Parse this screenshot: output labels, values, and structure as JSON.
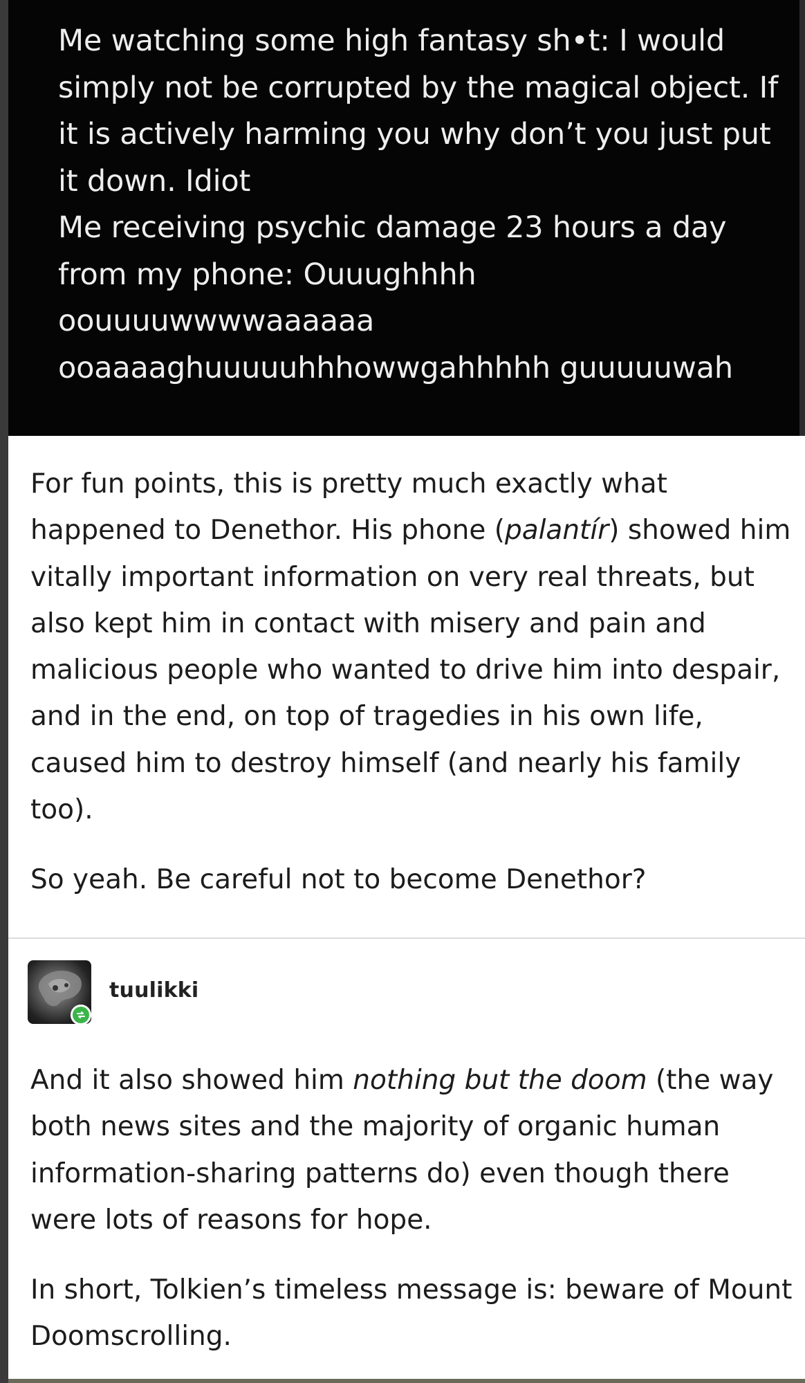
{
  "original_tweet": {
    "text": "Me watching some high fantasy sh•t: I would simply not be corrupted by the magical object. If it is actively harming you why don’t you just put it down. Idiot\nMe receiving psychic damage 23 hours a day from my phone: Ouuughhhh oouuuuwwwwaaaaaa ooaaaaghuuuuuhhhowwgahhhhh guuuuuwah"
  },
  "reply_1": {
    "p1_a": "For fun points, this is pretty much exactly what happened to Denethor. His phone (",
    "p1_italic": "palantír",
    "p1_b": ") showed him vitally important information on very real threats, but also kept him in contact with misery and pain and malicious people who wanted to drive him into despair, and in the end, on top of tragedies in his own life, caused him to destroy himself (and nearly his family too).",
    "p2": "So yeah. Be careful not to become Denethor?"
  },
  "reblogger": {
    "username": "tuulikki",
    "avatar_icon": "avatar-icon",
    "badge_icon": "reblog-icon",
    "badge_color": "#3bb54a"
  },
  "reply_2": {
    "p1_a": "And it also showed him ",
    "p1_italic": "nothing but the doom",
    "p1_b": " (the way both news sites and the majority of organic human information-sharing patterns do) even though there were lots of reasons for hope.",
    "p2": "In short, Tolkien’s timeless message is: beware of Mount Doomscrolling."
  }
}
